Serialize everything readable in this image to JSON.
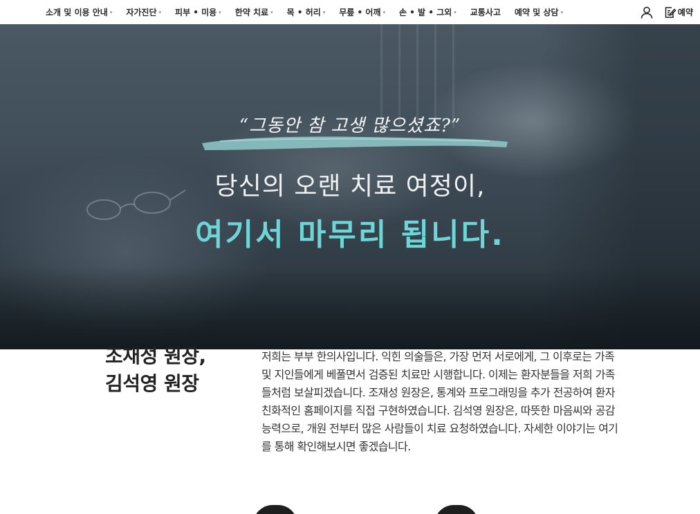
{
  "nav": {
    "items": [
      {
        "label": "소개 및 이용 안내",
        "dropdown": true
      },
      {
        "label": "자가진단",
        "dropdown": true
      },
      {
        "label": "피부 • 미용",
        "dropdown": true
      },
      {
        "label": "한약 치료",
        "dropdown": true
      },
      {
        "label": "목 • 허리",
        "dropdown": true
      },
      {
        "label": "무릎 • 어깨",
        "dropdown": true
      },
      {
        "label": "손 • 발 • 그외",
        "dropdown": true
      },
      {
        "label": "교통사고",
        "dropdown": false
      },
      {
        "label": "예약 및 상담",
        "dropdown": true
      }
    ],
    "caret": "▾",
    "user_icon": "user-icon",
    "reserve_icon": "edit-note-icon",
    "reserve_label": "예약"
  },
  "hero": {
    "slogan": "“그동안 참 고생 많으셨죠?”",
    "headline": "당신의 오랜 치료 여정이,",
    "headline_accent": "여기서 마무리 됩니다.",
    "accent_color": "#6fd6d8",
    "brush_color": "#8fc9c9"
  },
  "doctors": {
    "names": [
      "조재성 원장,",
      "김석영 원장"
    ],
    "description": "저희는 부부 한의사입니다. 익힌 의술들은, 가장 먼저 서로에게, 그 이후로는 가족 및 지인들에게 베풀면서 검증된 치료만 시행합니다. 이제는 환자분들을 저희 가족들처럼 보살피겠습니다. 조재성 원장은, 통계와 프로그래밍을 추가 전공하여 환자 친화적인 홈페이지를 직접 구현하였습니다. 김석영 원장은, 따뜻한 마음씨와 공감능력으로, 개원 전부터 많은 사람들이 치료 요청하였습니다. 자세한 이야기는 여기를 통해 확인해보시면 좋겠습니다."
  }
}
